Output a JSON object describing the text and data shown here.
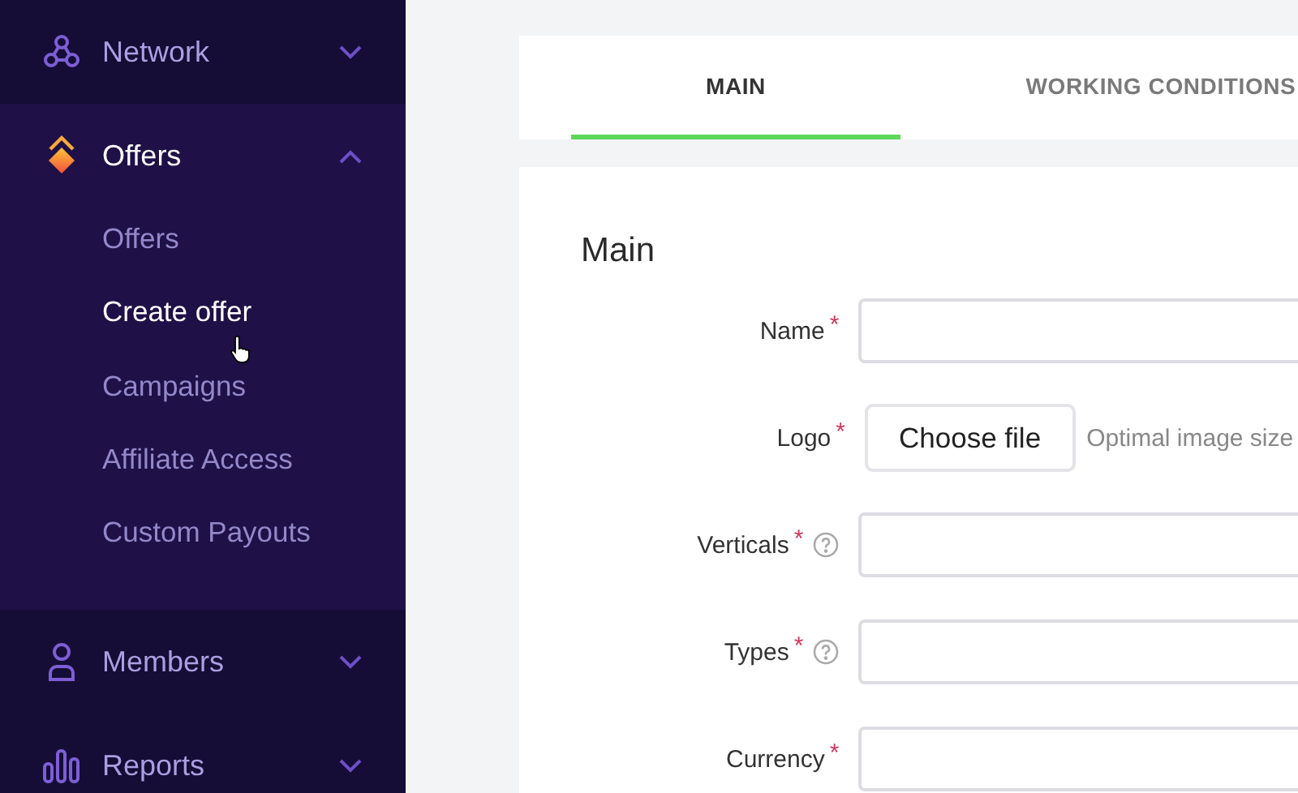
{
  "sidebar": {
    "sections": [
      {
        "label": "Network",
        "kind": "network",
        "expanded": false
      },
      {
        "label": "Offers",
        "kind": "offers",
        "expanded": true,
        "children": [
          {
            "label": "Offers",
            "selected": false
          },
          {
            "label": "Create offer",
            "selected": true
          },
          {
            "label": "Campaigns",
            "selected": false
          },
          {
            "label": "Affiliate Access",
            "selected": false
          },
          {
            "label": "Custom Payouts",
            "selected": false
          }
        ]
      },
      {
        "label": "Members",
        "kind": "members",
        "expanded": false
      },
      {
        "label": "Reports",
        "kind": "reports",
        "expanded": false
      }
    ]
  },
  "tabs": [
    {
      "label": "MAIN",
      "selected": true
    },
    {
      "label": "WORKING CONDITIONS",
      "selected": false
    }
  ],
  "form": {
    "title": "Main",
    "fields": [
      {
        "label": "Name",
        "kind": "text",
        "required_mark": "*",
        "help": false
      },
      {
        "label": "Logo",
        "kind": "file",
        "required_mark": "*",
        "help": false,
        "button": "Choose file",
        "hint": "Optimal image size"
      },
      {
        "label": "Verticals",
        "kind": "text",
        "required_mark": "*",
        "help": true
      },
      {
        "label": "Types",
        "kind": "text",
        "required_mark": "*",
        "help": true
      },
      {
        "label": "Currency",
        "kind": "text",
        "required_mark": "*",
        "help": false
      }
    ]
  }
}
